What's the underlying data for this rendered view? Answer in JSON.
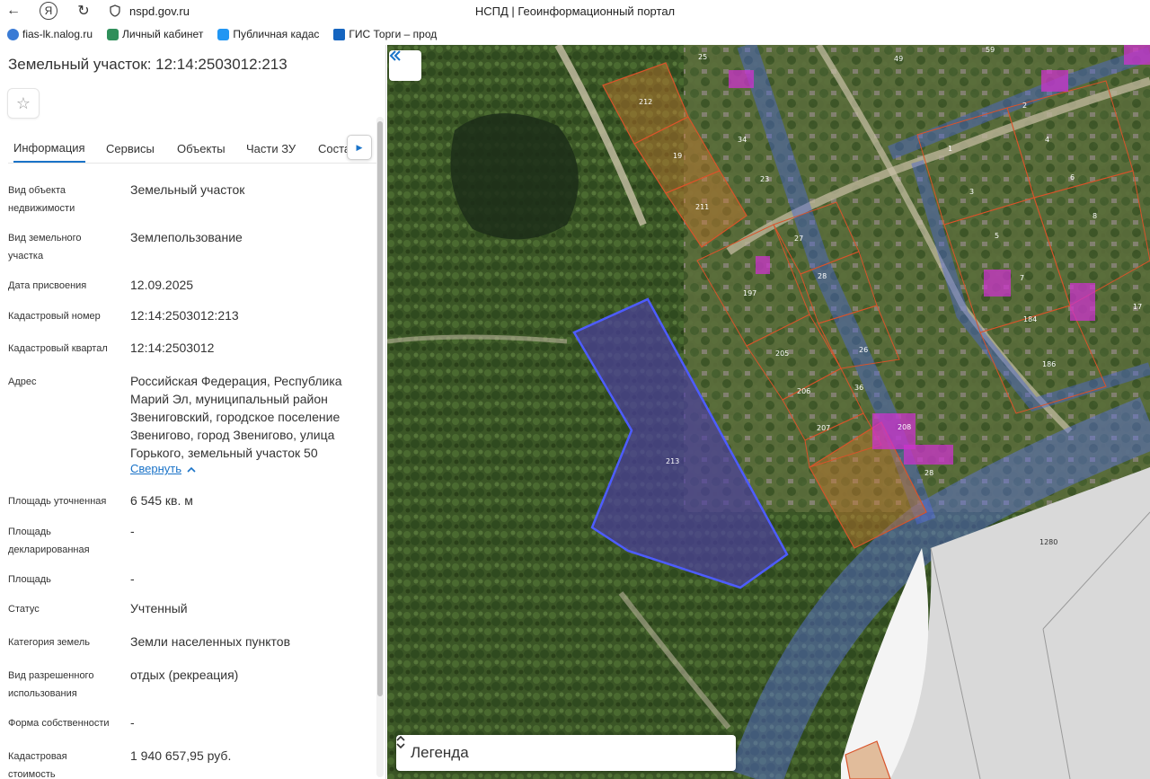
{
  "browser": {
    "url": "nspd.gov.ru",
    "page_title": "НСПД | Геоинформационный портал",
    "yandex_letter": "Я"
  },
  "bookmarks": [
    {
      "label": "fias-lk.nalog.ru",
      "color": "#3a7bd5"
    },
    {
      "label": "Личный кабинет",
      "color": "#2f8f5a"
    },
    {
      "label": "Публичная кадас",
      "color": "#2196f3"
    },
    {
      "label": "ГИС Торги – прод",
      "color": "#1565c0"
    }
  ],
  "panel": {
    "title": "Земельный участок: 12:14:2503012:213",
    "tabs": [
      "Информация",
      "Сервисы",
      "Объекты",
      "Части ЗУ",
      "Соста"
    ],
    "collapse_label": "Свернуть",
    "rows": [
      {
        "label": "Вид объекта недвижимости",
        "value": "Земельный участок"
      },
      {
        "label": "Вид земельного участка",
        "value": "Землепользование"
      },
      {
        "label": "Дата присвоения",
        "value": "12.09.2025"
      },
      {
        "label": "Кадастровый номер",
        "value": "12:14:2503012:213"
      },
      {
        "label": "Кадастровый квартал",
        "value": "12:14:2503012"
      },
      {
        "label": "Адрес",
        "value": "Российская Федерация, Республика Марий Эл, муниципальный район Звениговский, городское поселение Звенигово, город Звенигово, улица Горького, земельный участок 50"
      },
      {
        "label": "Площадь уточненная",
        "value": "6 545 кв. м"
      },
      {
        "label": "Площадь декларированная",
        "value": "-"
      },
      {
        "label": "Площадь",
        "value": "-"
      },
      {
        "label": "Статус",
        "value": "Учтенный"
      },
      {
        "label": "Категория земель",
        "value": "Земли населенных пунктов"
      },
      {
        "label": "Вид разрешенного использования",
        "value": "отдых (рекреация)"
      },
      {
        "label": "Форма собственности",
        "value": "-"
      },
      {
        "label": "Кадастровая стоимость",
        "value": "1 940 657,95 руб."
      }
    ]
  },
  "map": {
    "legend_label": "Легенда",
    "selected_plot_label": "213",
    "plot_labels": [
      "212",
      "19",
      "211",
      "197",
      "205",
      "206",
      "207",
      "27",
      "28",
      "26",
      "36",
      "208",
      "28",
      "25",
      "34",
      "23",
      "1",
      "3",
      "5",
      "7",
      "6",
      "8",
      "2",
      "4",
      "49",
      "59",
      "184",
      "186",
      "17",
      "1280"
    ],
    "colors": {
      "selected_fill": "#4b3fa0",
      "selected_stroke": "#4d5cff",
      "parcel_stroke": "#d9532a",
      "road_band": "#4a63d8",
      "accent_link": "#1a73c8"
    }
  }
}
